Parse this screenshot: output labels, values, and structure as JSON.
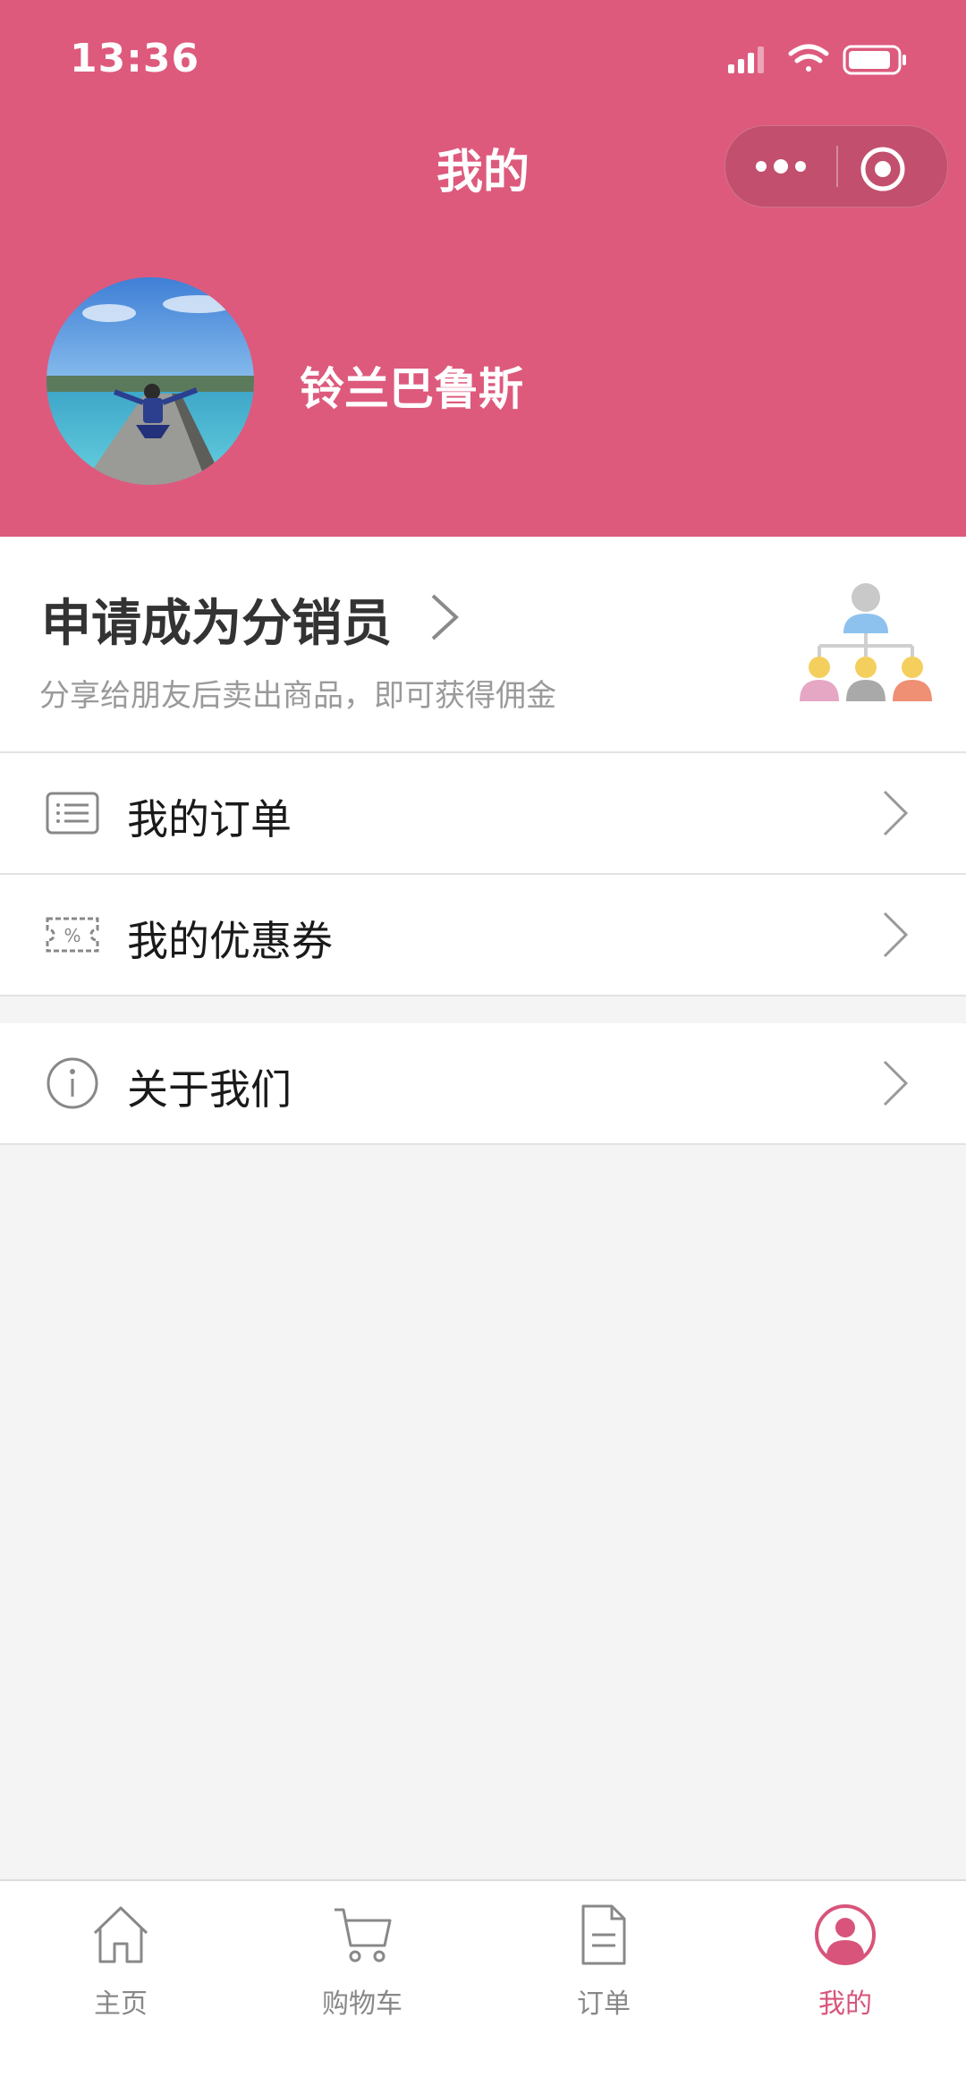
{
  "status_bar": {
    "time": "13:36"
  },
  "nav": {
    "title": "我的"
  },
  "profile": {
    "username": "铃兰巴鲁斯"
  },
  "distributor": {
    "title": "申请成为分销员",
    "subtitle": "分享给朋友后卖出商品，即可获得佣金"
  },
  "menu": {
    "orders": "我的订单",
    "coupons": "我的优惠券",
    "about": "关于我们"
  },
  "tabbar": {
    "items": [
      {
        "label": "主页",
        "icon": "home-icon"
      },
      {
        "label": "购物车",
        "icon": "cart-icon"
      },
      {
        "label": "订单",
        "icon": "document-icon"
      },
      {
        "label": "我的",
        "icon": "user-icon"
      }
    ],
    "active_index": 3
  },
  "colors": {
    "brand": "#dd5a7d",
    "tab_active": "#d8547a"
  }
}
